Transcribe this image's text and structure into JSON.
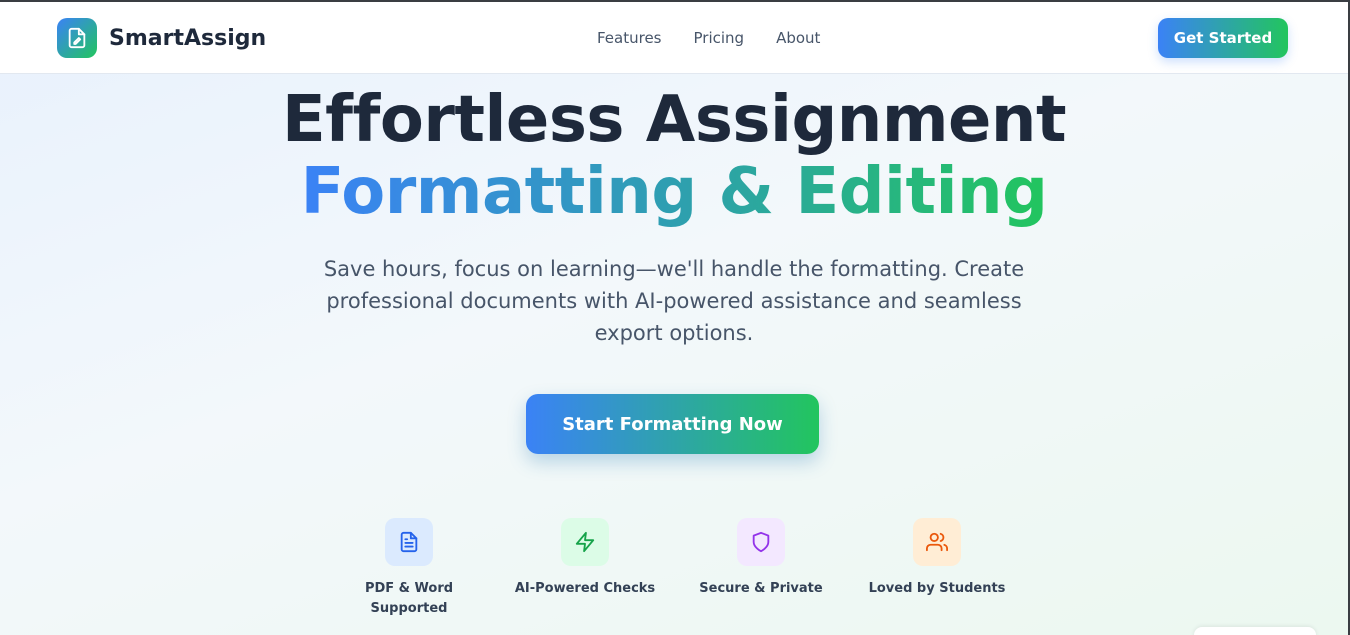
{
  "header": {
    "brand": "SmartAssign",
    "logo_icon": "document-pen-icon",
    "nav": [
      "Features",
      "Pricing",
      "About"
    ],
    "cta_label": "Get Started"
  },
  "hero": {
    "title_line1": "Effortless Assignment",
    "title_line2": "Formatting & Editing",
    "subtitle": "Save hours, focus on learning—we'll handle the formatting. Create professional documents with AI-powered assistance and seamless export options.",
    "cta_label": "Start Formatting Now"
  },
  "features": [
    {
      "label": "PDF & Word Supported",
      "icon": "document-icon",
      "color": "#2563eb"
    },
    {
      "label": "AI-Powered Checks",
      "icon": "lightning-icon",
      "color": "#16a34a"
    },
    {
      "label": "Secure & Private",
      "icon": "shield-icon",
      "color": "#9333ea"
    },
    {
      "label": "Loved by Students",
      "icon": "users-icon",
      "color": "#ea580c"
    }
  ],
  "colors": {
    "gradient_start": "#3b82f6",
    "gradient_end": "#22c55e",
    "heading": "#1e293b"
  }
}
